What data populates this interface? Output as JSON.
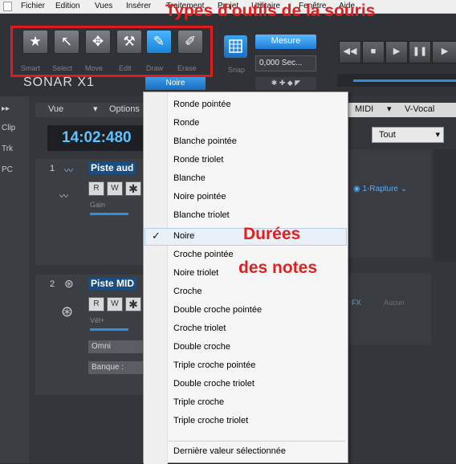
{
  "menubar": {
    "items": [
      "Fichier",
      "Edition",
      "Vues",
      "Insérer",
      "Traitement",
      "Projet",
      "Utilitaire",
      "Fenêtre",
      "Aide"
    ]
  },
  "annotation": {
    "title": "Types d'outils de la souris",
    "line1": "Durées",
    "line2": "des notes"
  },
  "tools": [
    {
      "name": "Smart",
      "icon": "star-icon",
      "glyph": "★"
    },
    {
      "name": "Select",
      "icon": "cursor-icon",
      "glyph": "↖"
    },
    {
      "name": "Move",
      "icon": "move-icon",
      "glyph": "✥"
    },
    {
      "name": "Edit",
      "icon": "wrench-icon",
      "glyph": "⚒"
    },
    {
      "name": "Draw",
      "icon": "pencil-icon",
      "glyph": "✎"
    },
    {
      "name": "Erase",
      "icon": "eraser-icon",
      "glyph": "✐"
    }
  ],
  "logo": "SONAR X1",
  "duration_select": "Noire",
  "snap": {
    "label": "Snap",
    "mode": "Mesure",
    "value": "0,000 Sec..."
  },
  "left_dock": [
    "Clip",
    "Trk",
    "PC"
  ],
  "track_view": {
    "vue_label": "Vue",
    "options_label": "Options",
    "timecode": "14:02:480"
  },
  "tracks": [
    {
      "number": "1",
      "name": "Piste aud",
      "gain": "Gain"
    },
    {
      "number": "2",
      "name": "Piste MID",
      "gain": "Vél+",
      "input": "Omni",
      "bank": "Banque :"
    }
  ],
  "right_panel": {
    "tabs": [
      "MIDI",
      "V-Vocal"
    ],
    "filter": "Tout",
    "synth": "1-Rapture",
    "fx": "FX",
    "fx_value": "Aucun"
  },
  "menu": {
    "items": [
      "Ronde pointée",
      "Ronde",
      "Blanche pointée",
      "Ronde triolet",
      "Blanche",
      "Noire pointée",
      "Blanche triolet",
      "Noire",
      "Croche pointée",
      "Noire triolet",
      "Croche",
      "Double croche pointée",
      "Croche triolet",
      "Double croche",
      "Triple croche pointée",
      "Double croche triolet",
      "Triple croche",
      "Triple croche triolet"
    ],
    "checked": "Noire",
    "footer": "Dernière valeur sélectionnée"
  },
  "colors": {
    "accent": "#1f86dc",
    "annotation": "#e51e1e"
  }
}
